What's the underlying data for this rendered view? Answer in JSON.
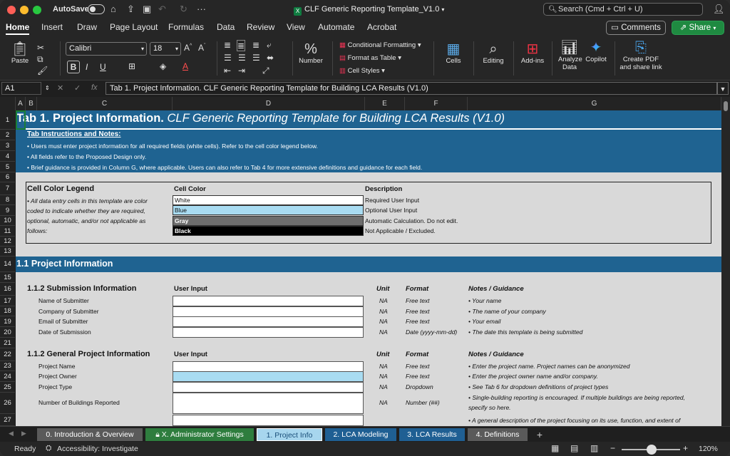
{
  "titlebar": {
    "autosave_label": "AutoSave",
    "document_title": "CLF Generic Reporting Template_V1.0",
    "search_placeholder": "Search (Cmd + Ctrl + U)"
  },
  "ribbon_tabs": [
    "Home",
    "Insert",
    "Draw",
    "Page Layout",
    "Formulas",
    "Data",
    "Review",
    "View",
    "Automate",
    "Acrobat"
  ],
  "buttons": {
    "comments": "Comments",
    "share": "Share"
  },
  "ribbon": {
    "paste": "Paste",
    "font_name": "Calibri",
    "font_size": "18",
    "number": "Number",
    "conditional_formatting": "Conditional Formatting",
    "format_as_table": "Format as Table",
    "cell_styles": "Cell Styles",
    "cells": "Cells",
    "editing": "Editing",
    "add_ins": "Add-ins",
    "analyze_data": "Analyze Data",
    "copilot": "Copilot",
    "create_pdf": "Create PDF and share link"
  },
  "formula_bar": {
    "name_box": "A1",
    "formula": "Tab 1. Project Information. CLF Generic Reporting Template for Building LCA Results (V1.0)"
  },
  "columns": [
    "A",
    "B",
    "C",
    "D",
    "E",
    "F",
    "G"
  ],
  "rows": [
    "1",
    "2",
    "3",
    "4",
    "5",
    "6",
    "7",
    "8",
    "9",
    "10",
    "11",
    "12",
    "13",
    "14",
    "15",
    "16",
    "17",
    "18",
    "19",
    "20",
    "21",
    "22",
    "23",
    "24",
    "25",
    "26",
    "27"
  ],
  "sheet": {
    "title_bold": "Tab 1. Project Information.",
    "title_italic": " CLF Generic Reporting Template for Building LCA Results (V1.0)",
    "instructions_heading": "Tab Instructions and Notes:",
    "instructions": [
      "• Users must enter project information for all required fields (white cells). Refer to the cell color legend below.",
      "• All fields refer to the Proposed Design only.",
      "• Brief guidance is provided in Column G, where applicable. Users can also refer to Tab 4 for more extensive definitions and guidance for each field."
    ],
    "legend": {
      "title": "Cell Color Legend",
      "note_lines": [
        "• All data entry cells in this template are color",
        "coded to indicate whether they are required,",
        "optional, automatic, and/or not applicable as",
        "follows:"
      ],
      "col_cell_color": "Cell Color",
      "col_description": "Description",
      "items": [
        {
          "label": "White",
          "description": "Required User Input",
          "color": "#ffffff"
        },
        {
          "label": "Blue",
          "description": "Optional User Input",
          "color": "#a9dcf2"
        },
        {
          "label": "Gray",
          "description": "Automatic Calculation. Do not edit.",
          "color": "#6e6e6e"
        },
        {
          "label": "Black",
          "description": "Not Applicable / Excluded.",
          "color": "#000000"
        }
      ]
    },
    "section_title": "1.1 Project Information",
    "submission": {
      "title": "1.1.2 Submission Information",
      "col_user_input": "User Input",
      "col_unit": "Unit",
      "col_format": "Format",
      "col_notes": "Notes / Guidance",
      "rows": [
        {
          "label": "Name of Submitter",
          "unit": "NA",
          "format": "Free text",
          "note": "• Your name"
        },
        {
          "label": "Company of Submitter",
          "unit": "NA",
          "format": "Free text",
          "note": "• The name of your company"
        },
        {
          "label": "Email of Submitter",
          "unit": "NA",
          "format": "Free text",
          "note": "• Your email"
        },
        {
          "label": "Date of Submission",
          "unit": "NA",
          "format": "Date (yyyy-mm-dd)",
          "note": "• The date this template is being submitted"
        }
      ]
    },
    "general": {
      "title": "1.1.2 General Project Information",
      "col_user_input": "User Input",
      "col_unit": "Unit",
      "col_format": "Format",
      "col_notes": "Notes / Guidance",
      "rows": [
        {
          "label": "Project Name",
          "unit": "NA",
          "format": "Free text",
          "note": "• Enter the project name. Project names can be anonymized"
        },
        {
          "label": "Project Owner",
          "unit": "NA",
          "format": "Free text",
          "note": "• Enter the project owner name and/or company."
        },
        {
          "label": "Project Type",
          "unit": "NA",
          "format": "Dropdown",
          "note": "• See Tab 6 for dropdown definitions of project types"
        },
        {
          "label": "Number of Buildings Reported",
          "unit": "NA",
          "format": "Number (##)",
          "note": "• Single-building reporting is encouraged. If multiple buildings are being reported,",
          "note2": "specify so here."
        }
      ],
      "next_note_partial": "• A general description of the project focusing on its use, function, and extent of"
    }
  },
  "sheet_tabs": [
    {
      "label": "0. Introduction & Overview",
      "color": "#5a5a5a"
    },
    {
      "label": "X. Administrator Settings",
      "color": "#2e7d3e"
    },
    {
      "label": "1. Project Info",
      "color": "#a7d6ee"
    },
    {
      "label": "2. LCA Modeling",
      "color": "#1f5f93"
    },
    {
      "label": "3. LCA Results",
      "color": "#1f5f93"
    },
    {
      "label": "4. Definitions",
      "color": "#5a5a5a"
    }
  ],
  "status": {
    "ready": "Ready",
    "accessibility": "Accessibility: Investigate",
    "zoom": "120%"
  }
}
